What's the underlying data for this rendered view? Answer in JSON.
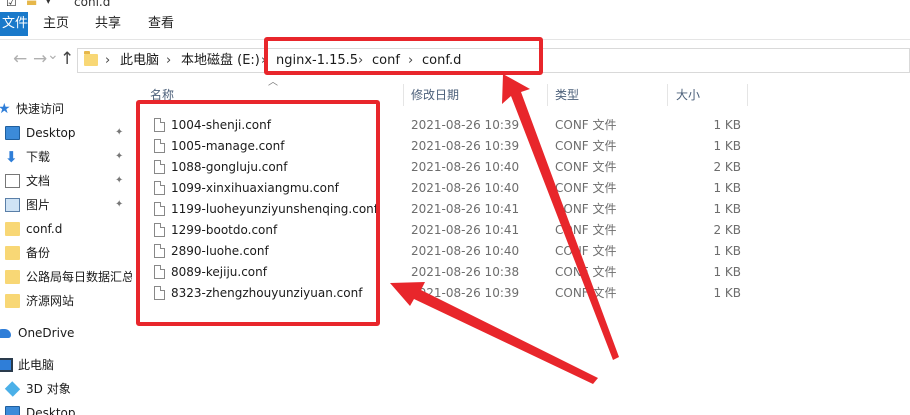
{
  "window": {
    "title": "conf.d"
  },
  "ribbon": {
    "file_tab": "文件",
    "tabs": [
      "主页",
      "共享",
      "查看"
    ]
  },
  "address": {
    "path": [
      "此电脑",
      "本地磁盘 (E:)",
      "nginx-1.15.5",
      "conf",
      "conf.d"
    ],
    "separator": "›"
  },
  "nav": {
    "back": "←",
    "forward": "→",
    "dropdown": "⌄",
    "up": "↑",
    "pin": "📌",
    "items": [
      {
        "label": "快速访问",
        "icon": "star-icon"
      },
      {
        "label": "Desktop",
        "icon": "desktop-icon",
        "pinned": true
      },
      {
        "label": "下载",
        "icon": "download-icon",
        "pinned": true
      },
      {
        "label": "文档",
        "icon": "document-icon",
        "pinned": true
      },
      {
        "label": "图片",
        "icon": "picture-icon",
        "pinned": true
      },
      {
        "label": "conf.d",
        "icon": "folder-icon"
      },
      {
        "label": "备份",
        "icon": "folder-icon"
      },
      {
        "label": "公路局每日数据汇总",
        "icon": "folder-icon"
      },
      {
        "label": "济源网站",
        "icon": "folder-icon"
      },
      {
        "label": "OneDrive",
        "icon": "cloud-icon"
      },
      {
        "label": "此电脑",
        "icon": "computer-icon"
      },
      {
        "label": "3D 对象",
        "icon": "3d-objects-icon"
      },
      {
        "label": "Desktop",
        "icon": "desktop-icon"
      }
    ]
  },
  "columns": {
    "name": "名称",
    "date": "修改日期",
    "type": "类型",
    "size": "大小"
  },
  "files": [
    {
      "name": "1004-shenji.conf",
      "date": "2021-08-26 10:39",
      "type": "CONF 文件",
      "size": "1 KB"
    },
    {
      "name": "1005-manage.conf",
      "date": "2021-08-26 10:39",
      "type": "CONF 文件",
      "size": "1 KB"
    },
    {
      "name": "1088-gongluju.conf",
      "date": "2021-08-26 10:40",
      "type": "CONF 文件",
      "size": "2 KB"
    },
    {
      "name": "1099-xinxihuaxiangmu.conf",
      "date": "2021-08-26 10:40",
      "type": "CONF 文件",
      "size": "1 KB"
    },
    {
      "name": "1199-luoheyunziyunshenqing.conf",
      "date": "2021-08-26 10:41",
      "type": "CONF 文件",
      "size": "1 KB"
    },
    {
      "name": "1299-bootdo.conf",
      "date": "2021-08-26 10:41",
      "type": "CONF 文件",
      "size": "2 KB"
    },
    {
      "name": "2890-luohe.conf",
      "date": "2021-08-26 10:40",
      "type": "CONF 文件",
      "size": "1 KB"
    },
    {
      "name": "8089-kejiju.conf",
      "date": "2021-08-26 10:38",
      "type": "CONF 文件",
      "size": "1 KB"
    },
    {
      "name": "8323-zhengzhouyunziyuan.conf",
      "date": "2021-08-26 10:39",
      "type": "CONF 文件",
      "size": "1 KB"
    }
  ],
  "colors": {
    "annotation": "#e8262b",
    "file_tab": "#1979ca",
    "folder": "#f8d775"
  }
}
